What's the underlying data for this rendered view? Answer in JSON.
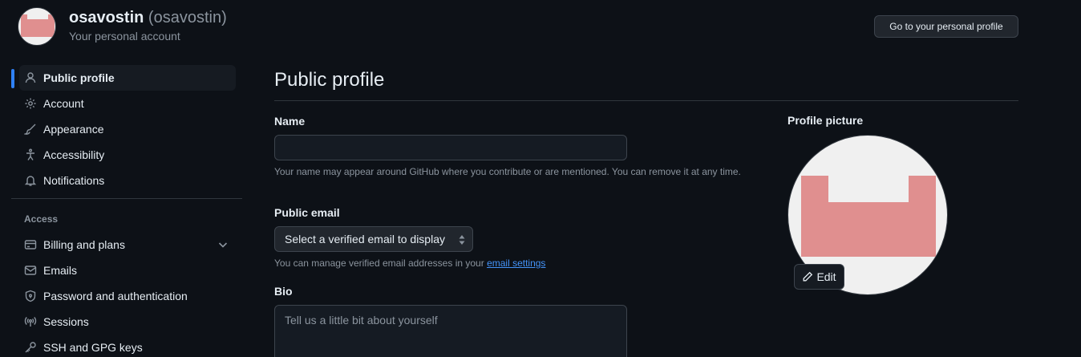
{
  "account": {
    "name": "osavostin",
    "login": "(osavostin)",
    "subtitle": "Your personal account",
    "profile_button": "Go to your personal profile"
  },
  "sidebar": {
    "items": [
      {
        "label": "Public profile",
        "icon": "person-icon",
        "active": true
      },
      {
        "label": "Account",
        "icon": "gear-icon"
      },
      {
        "label": "Appearance",
        "icon": "paintbrush-icon"
      },
      {
        "label": "Accessibility",
        "icon": "accessibility-icon"
      },
      {
        "label": "Notifications",
        "icon": "bell-icon"
      }
    ],
    "access_heading": "Access",
    "access_items": [
      {
        "label": "Billing and plans",
        "icon": "credit-card-icon",
        "expandable": true
      },
      {
        "label": "Emails",
        "icon": "mail-icon"
      },
      {
        "label": "Password and authentication",
        "icon": "shield-lock-icon"
      },
      {
        "label": "Sessions",
        "icon": "broadcast-icon"
      },
      {
        "label": "SSH and GPG keys",
        "icon": "key-icon"
      }
    ]
  },
  "main": {
    "title": "Public profile",
    "name": {
      "label": "Name",
      "value": "",
      "hint": "Your name may appear around GitHub where you contribute or are mentioned. You can remove it at any time."
    },
    "public_email": {
      "label": "Public email",
      "selected": "Select a verified email to display",
      "hint_prefix": "You can manage verified email addresses in your",
      "hint_link": "email settings"
    },
    "bio": {
      "label": "Bio",
      "placeholder": "Tell us a little bit about yourself"
    },
    "profile_picture": {
      "label": "Profile picture",
      "edit_label": "Edit"
    }
  },
  "colors": {
    "background": "#0d1117",
    "accent": "#2f81f7",
    "link": "#4493f8",
    "avatar": "#e08f8f"
  }
}
